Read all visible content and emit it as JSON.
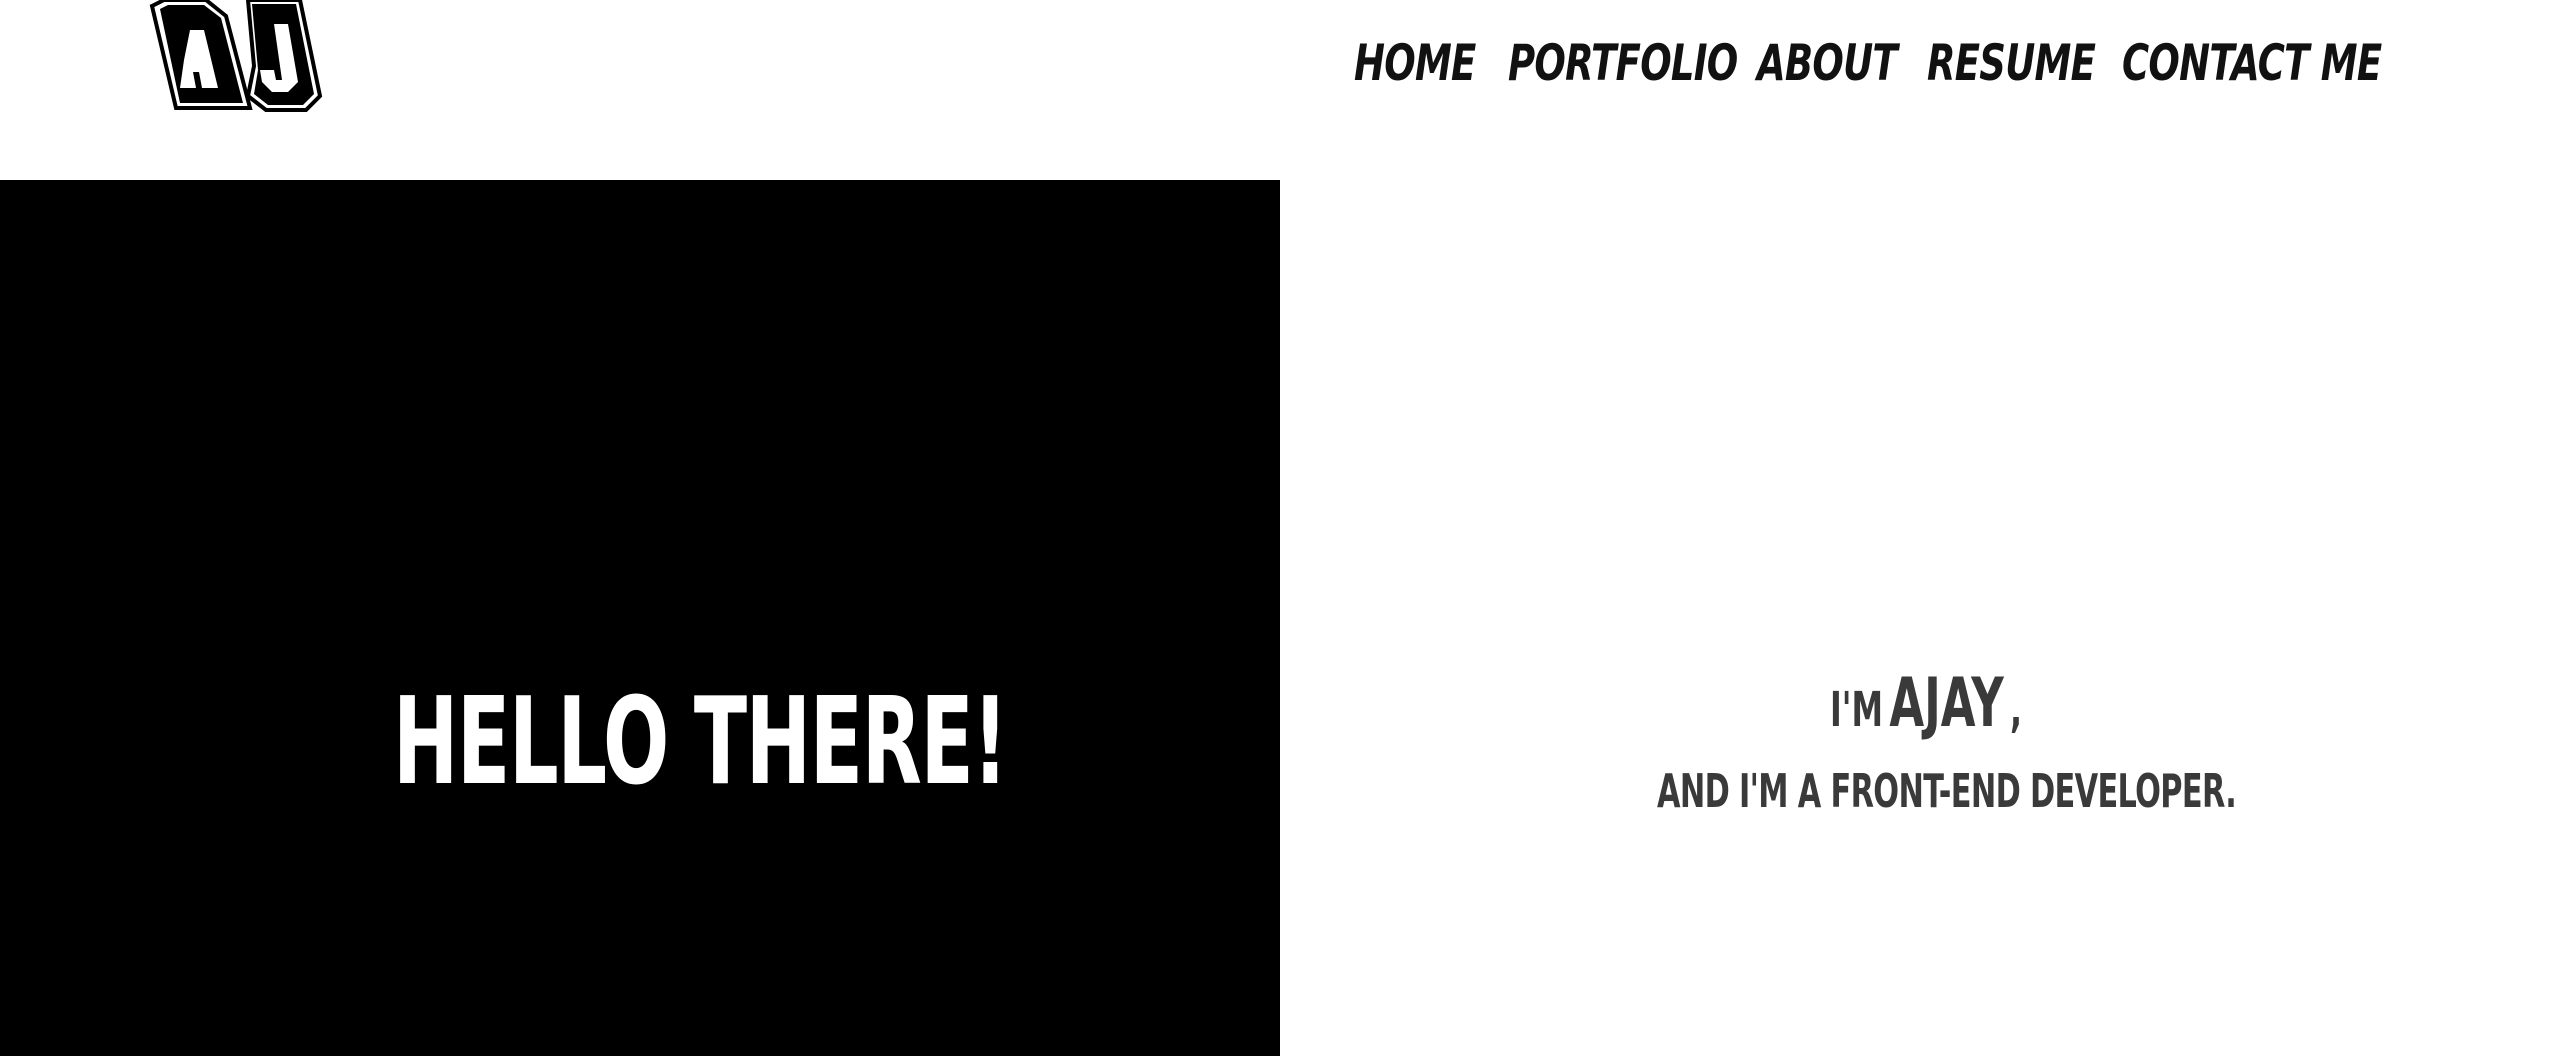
{
  "header": {
    "logo": {
      "letters": "AJ",
      "icon": "aj-monogram-logo"
    },
    "nav": [
      {
        "label": "HOME"
      },
      {
        "label": "PORTFOLIO"
      },
      {
        "label": "ABOUT"
      },
      {
        "label": "RESUME"
      },
      {
        "label": "CONTACT ME"
      }
    ]
  },
  "hero": {
    "title": "HELLO THERE!",
    "intro_prefix": "I'M",
    "name": "AJAY",
    "intro_suffix": ",",
    "tagline": "AND I'M A FRONT-END DEVELOPER."
  },
  "colors": {
    "background": "#ffffff",
    "hero_panel": "#000000",
    "nav_text": "#111111",
    "intro_text": "#3a3a3a"
  }
}
